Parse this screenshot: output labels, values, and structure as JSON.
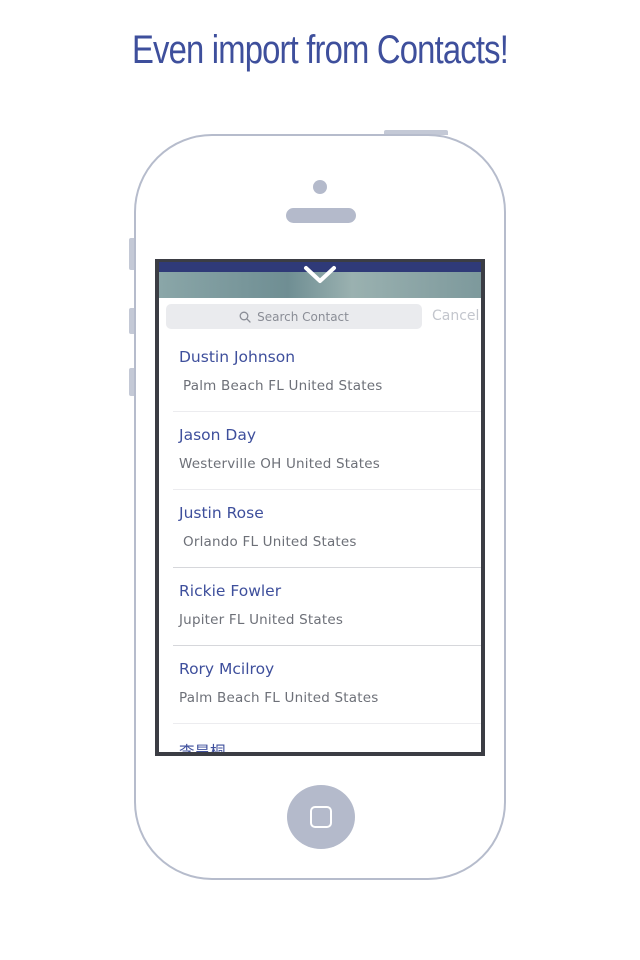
{
  "headline": "Even import from Contacts!",
  "search": {
    "placeholder": "Search Contact",
    "cancel_label": "Cancel"
  },
  "contacts": [
    {
      "name": "Dustin Johnson",
      "location": "Palm Beach FL United States"
    },
    {
      "name": "Jason Day",
      "location": "Westerville  OH United States"
    },
    {
      "name": "Justin Rose",
      "location": "Orlando FL United States"
    },
    {
      "name": "Rickie Fowler",
      "location": "Jupiter  FL United States"
    },
    {
      "name": "Rory Mcilroy",
      "location": "Palm Beach  FL United States"
    },
    {
      "name": "李昊桐",
      "location": ""
    }
  ],
  "colors": {
    "accent": "#3e4f9c",
    "phone_outline": "#b6bccc",
    "screen_frame": "#3b3d44"
  },
  "icons": [
    "chevron-down-icon",
    "search-icon",
    "home-button-icon"
  ]
}
